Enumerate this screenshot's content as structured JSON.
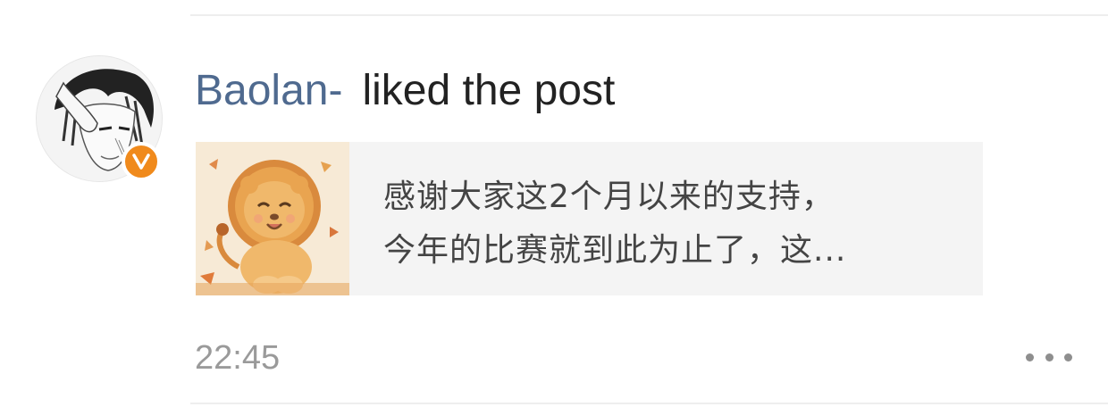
{
  "notification": {
    "username": "Baolan-",
    "action": "liked the post",
    "timestamp": "22:45"
  },
  "post": {
    "line1": "感谢大家这2个月以来的支持，",
    "line2": "今年的比赛就到此为止了，这..."
  },
  "icons": {
    "verified": "verified-v-badge-icon",
    "more": "more-horizontal-icon"
  },
  "colors": {
    "username": "#4f6a8f",
    "badge": "#f08a1c",
    "timestamp": "#9a9a9a",
    "preview_bg": "#f4f4f4"
  }
}
